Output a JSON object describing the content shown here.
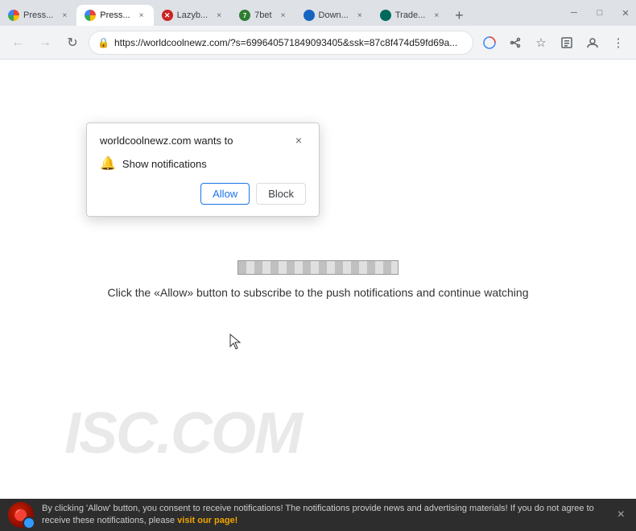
{
  "window": {
    "minimize": "─",
    "maximize": "□",
    "close": "✕"
  },
  "tabs": [
    {
      "id": "tab1",
      "label": "Press...",
      "favicon_type": "chrome",
      "active": false
    },
    {
      "id": "tab2",
      "label": "Press...",
      "favicon_type": "chrome",
      "active": true
    },
    {
      "id": "tab3",
      "label": "Lazyb...",
      "favicon_type": "red-x",
      "active": false
    },
    {
      "id": "tab4",
      "label": "7bet",
      "favicon_type": "green7",
      "active": false
    },
    {
      "id": "tab5",
      "label": "Down...",
      "favicon_type": "blue",
      "active": false
    },
    {
      "id": "tab6",
      "label": "Trade...",
      "favicon_type": "teal",
      "active": false
    }
  ],
  "addressbar": {
    "url": "https://worldcoolnewz.com/?s=699640571849093405&ssk=87c8f474d59fd69a...",
    "lock_symbol": "🔒"
  },
  "toolbar": {
    "back": "←",
    "forward": "→",
    "refresh": "↻",
    "bookmark": "☆",
    "extensions": "🧩",
    "menu": "⋮",
    "profile": "👤",
    "cast": "📡",
    "google_apps": "⊞"
  },
  "popup": {
    "title": "worldcoolnewz.com wants to",
    "close_symbol": "×",
    "notification_label": "Show notifications",
    "allow_label": "Allow",
    "block_label": "Block"
  },
  "page": {
    "main_text": "Click the «Allow» button to subscribe to the push notifications and continue watching"
  },
  "notification_bar": {
    "text_before": "By clicking 'Allow' button, you consent to receive notifications! The notifications provide news and advertising materials! If you do not agree to receive these notifications, please ",
    "link_text": "visit our page!",
    "close": "×"
  },
  "watermark": {
    "text": "ISC.COM"
  }
}
